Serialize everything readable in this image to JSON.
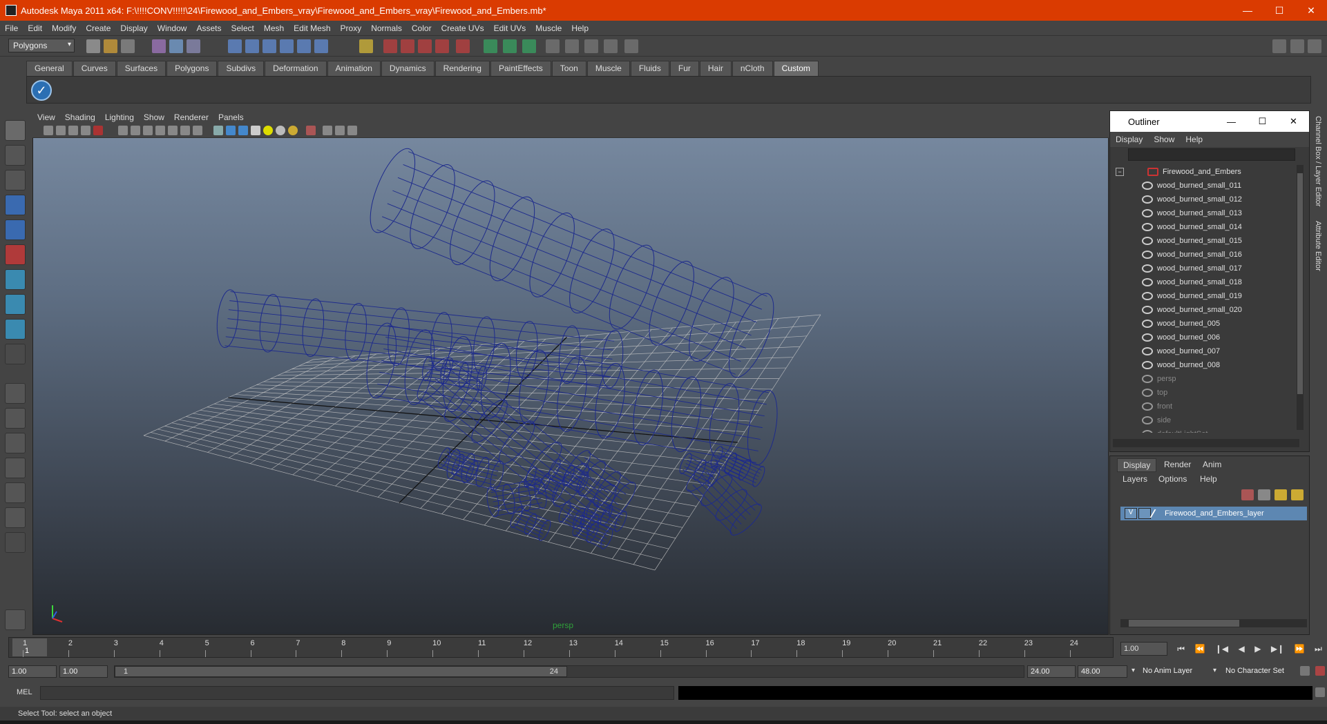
{
  "window": {
    "title": "Autodesk Maya 2011 x64: F:\\!!!!CONV!!!!!\\24\\Firewood_and_Embers_vray\\Firewood_and_Embers_vray\\Firewood_and_Embers.mb*",
    "minimize": "—",
    "maximize": "☐",
    "close": "✕"
  },
  "menubar": [
    "File",
    "Edit",
    "Modify",
    "Create",
    "Display",
    "Window",
    "Assets",
    "Select",
    "Mesh",
    "Edit Mesh",
    "Proxy",
    "Normals",
    "Color",
    "Create UVs",
    "Edit UVs",
    "Muscle",
    "Help"
  ],
  "status": {
    "mode": "Polygons"
  },
  "shelf": {
    "tabs": [
      "General",
      "Curves",
      "Surfaces",
      "Polygons",
      "Subdivs",
      "Deformation",
      "Animation",
      "Dynamics",
      "Rendering",
      "PaintEffects",
      "Toon",
      "Muscle",
      "Fluids",
      "Fur",
      "Hair",
      "nCloth",
      "Custom"
    ],
    "active": "Custom",
    "check_glyph": "✓"
  },
  "panel": {
    "menus": [
      "View",
      "Shading",
      "Lighting",
      "Show",
      "Renderer",
      "Panels"
    ],
    "camera_label": "persp",
    "colors": {
      "wire": "#1d2a8c",
      "grid": "#c8c8c8"
    }
  },
  "outliner": {
    "title": "Outliner",
    "menus": [
      "Display",
      "Show",
      "Help"
    ],
    "root": "Firewood_and_Embers",
    "children": [
      "wood_burned_small_011",
      "wood_burned_small_012",
      "wood_burned_small_013",
      "wood_burned_small_014",
      "wood_burned_small_015",
      "wood_burned_small_016",
      "wood_burned_small_017",
      "wood_burned_small_018",
      "wood_burned_small_019",
      "wood_burned_small_020",
      "wood_burned_005",
      "wood_burned_006",
      "wood_burned_007",
      "wood_burned_008"
    ],
    "cameras": [
      "persp",
      "top",
      "front",
      "side"
    ],
    "partial": "defaultLightSet"
  },
  "layers": {
    "tabs": [
      "Display",
      "Render",
      "Anim"
    ],
    "active_tab": "Display",
    "menus": [
      "Layers",
      "Options",
      "Help"
    ],
    "layer_name": "Firewood_and_Embers_layer",
    "visible_flag": "V"
  },
  "side_tabs": [
    "Channel Box / Layer Editor",
    "Attribute Editor"
  ],
  "timeline": {
    "ticks": [
      "1",
      "2",
      "3",
      "4",
      "5",
      "6",
      "7",
      "8",
      "9",
      "10",
      "11",
      "12",
      "13",
      "14",
      "15",
      "16",
      "17",
      "18",
      "19",
      "20",
      "21",
      "22",
      "23",
      "24"
    ],
    "current_frame": "1",
    "current_time_field": "1.00",
    "playback_buttons": [
      "⏮",
      "⏪",
      "❙◀",
      "◀",
      "▶",
      "▶❙",
      "⏩",
      "⏭"
    ]
  },
  "range": {
    "start": "1.00",
    "anim_start": "1.00",
    "slider_start": "1",
    "slider_end": "24",
    "end": "24.00",
    "anim_end": "48.00",
    "anim_layer": "No Anim Layer",
    "character_set": "No Character Set"
  },
  "command": {
    "label": "MEL"
  },
  "help_line": "Select Tool: select an object"
}
